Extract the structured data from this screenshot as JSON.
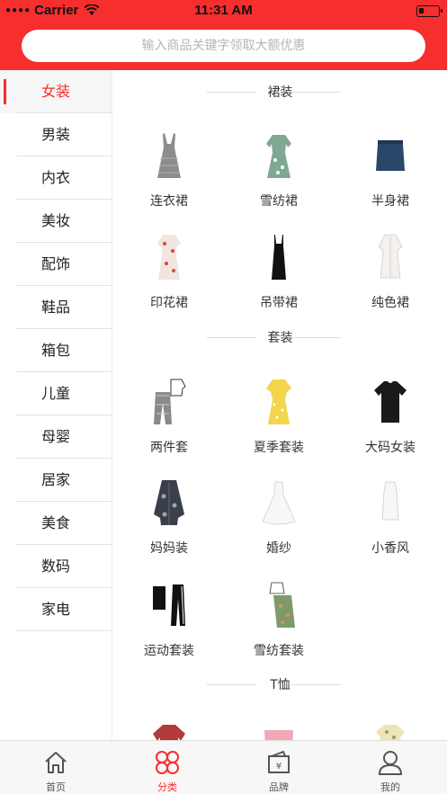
{
  "status": {
    "carrier": "Carrier",
    "time": "11:31 AM"
  },
  "search": {
    "placeholder": "输入商品关键字领取大额优惠"
  },
  "sidebar": {
    "items": [
      {
        "label": "女装",
        "active": true
      },
      {
        "label": "男装"
      },
      {
        "label": "内衣"
      },
      {
        "label": "美妆"
      },
      {
        "label": "配饰"
      },
      {
        "label": "鞋品"
      },
      {
        "label": "箱包"
      },
      {
        "label": "儿童"
      },
      {
        "label": "母婴"
      },
      {
        "label": "居家"
      },
      {
        "label": "美食"
      },
      {
        "label": "数码"
      },
      {
        "label": "家电"
      }
    ]
  },
  "sections": [
    {
      "title": "裙装",
      "items": [
        {
          "label": "连衣裙",
          "icon": "gray-plaid-dress-icon"
        },
        {
          "label": "雪纺裙",
          "icon": "floral-chiffon-dress-icon"
        },
        {
          "label": "半身裙",
          "icon": "denim-skirt-icon"
        },
        {
          "label": "印花裙",
          "icon": "print-dress-icon"
        },
        {
          "label": "吊带裙",
          "icon": "black-slip-dress-icon"
        },
        {
          "label": "纯色裙",
          "icon": "white-shirt-dress-icon"
        }
      ]
    },
    {
      "title": "套装",
      "items": [
        {
          "label": "两件套",
          "icon": "two-piece-set-icon"
        },
        {
          "label": "夏季套装",
          "icon": "yellow-summer-dress-icon"
        },
        {
          "label": "大码女装",
          "icon": "black-tshirt-icon"
        },
        {
          "label": "妈妈装",
          "icon": "floral-cardigan-icon"
        },
        {
          "label": "婚纱",
          "icon": "wedding-gown-icon"
        },
        {
          "label": "小香风",
          "icon": "white-top-icon"
        },
        {
          "label": "运动套装",
          "icon": "sportswear-set-icon"
        },
        {
          "label": "雪纺套装",
          "icon": "chiffon-set-icon"
        }
      ]
    },
    {
      "title": "T恤",
      "items": [
        {
          "label": "",
          "icon": "red-tshirt-icon"
        },
        {
          "label": "",
          "icon": "pink-tshirt-icon"
        },
        {
          "label": "",
          "icon": "floral-tshirt-icon"
        }
      ]
    }
  ],
  "tabbar": {
    "items": [
      {
        "label": "首页",
        "icon": "home-icon"
      },
      {
        "label": "分类",
        "icon": "category-icon",
        "active": true
      },
      {
        "label": "品牌",
        "icon": "brand-icon"
      },
      {
        "label": "我的",
        "icon": "profile-icon"
      }
    ]
  },
  "colors": {
    "brand": "#f72e2e",
    "sidebar_active_bg": "#f6f6f6",
    "tabbar_bg": "#f7f7f7"
  }
}
